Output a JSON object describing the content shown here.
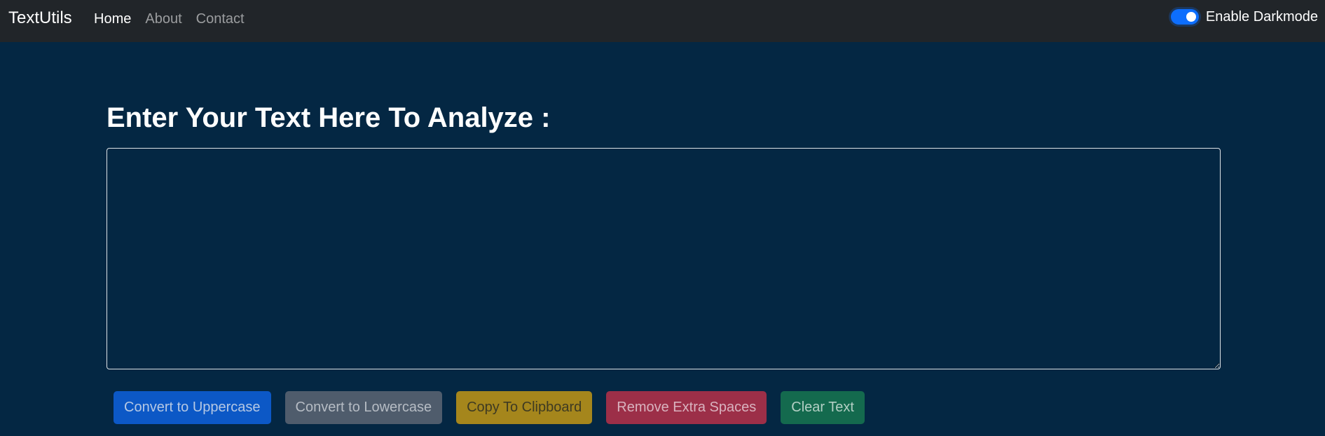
{
  "navbar": {
    "brand": "TextUtils",
    "links": [
      {
        "label": "Home",
        "active": true
      },
      {
        "label": "About",
        "active": false
      },
      {
        "label": "Contact",
        "active": false
      }
    ],
    "darkmode_label": "Enable Darkmode",
    "darkmode_enabled": true
  },
  "main": {
    "heading": "Enter Your Text Here To Analyze :",
    "textarea_value": "",
    "buttons": {
      "uppercase": "Convert to Uppercase",
      "lowercase": "Convert to Lowercase",
      "copy": "Copy To Clipboard",
      "remove_spaces": "Remove Extra Spaces",
      "clear": "Clear Text"
    }
  },
  "colors": {
    "background": "#042743",
    "navbar": "#212529",
    "toggle_accent": "#0d6efd"
  }
}
